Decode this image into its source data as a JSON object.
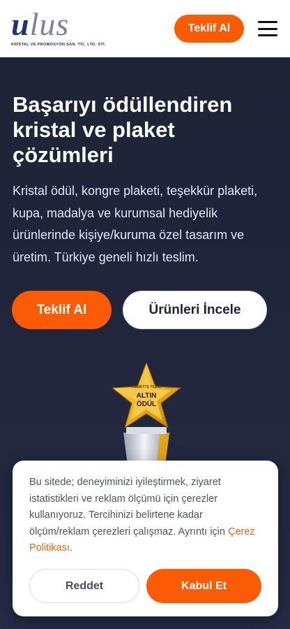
{
  "header": {
    "logo_u": "u",
    "logo_rest": "lus",
    "logo_subtitle": "KRİSTAL VE PROMOSYON SAN. TİC. LTD. STİ.",
    "cta_label": "Teklif Al"
  },
  "hero": {
    "title": "Başarıyı ödüllendiren kristal ve plaket çözümleri",
    "description": "Kristal ödül, kongre plaketi, teşekkür plaketi, kupa, madalya ve kurumsal hediyelik ürünlerinde kişiye/kuruma özel tasarım ve üretim. Türkiye geneli hızlı teslim.",
    "primary_label": "Teklif Al",
    "secondary_label": "Ürünleri İncele",
    "trophy_small": "HİZMETTE YILDIZ",
    "trophy_line1": "ALTIN",
    "trophy_line2": "ÖDÜL"
  },
  "cookie": {
    "text": "Bu sitede; deneyiminizi iyileştirmek, ziyaret istatistikleri ve reklam ölçümü için çerezler kullanıyoruz. Tercihinizi belirtene kadar ölçüm/reklam çerezleri çalışmaz. Ayrıntı için ",
    "link_label": "Çerez Politikası",
    "text_end": ".",
    "reject_label": "Reddet",
    "accept_label": "Kabul Et"
  },
  "colors": {
    "accent": "#fb5b05",
    "background": "#1e2235",
    "logo_blue": "#1f3572"
  },
  "icons": {
    "menu": "hamburger-menu-icon",
    "trophy": "star-trophy-icon"
  }
}
